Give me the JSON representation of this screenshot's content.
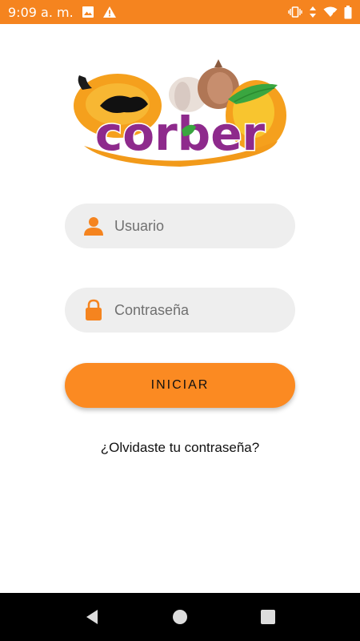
{
  "status_bar": {
    "time": "9:09 a. m.",
    "left_icons": [
      "image-icon",
      "warning-icon"
    ],
    "right_icons": [
      "vibrate-icon",
      "data-arrows-icon",
      "wifi-icon",
      "battery-icon"
    ],
    "color": "#f5841f"
  },
  "logo": {
    "text": "corber",
    "colors": {
      "purple": "#8e2a8c",
      "orange": "#f7a21b",
      "green": "#3aa640"
    }
  },
  "login": {
    "username_placeholder": "Usuario",
    "password_placeholder": "Contraseña",
    "submit_label": "INICIAR",
    "forgot_label": "¿Olvidaste tu contraseña?",
    "accent_color": "#fb8a22",
    "field_bg": "#eeeeee"
  },
  "nav_bar": {
    "buttons": [
      "back-icon",
      "home-icon",
      "recents-icon"
    ]
  }
}
